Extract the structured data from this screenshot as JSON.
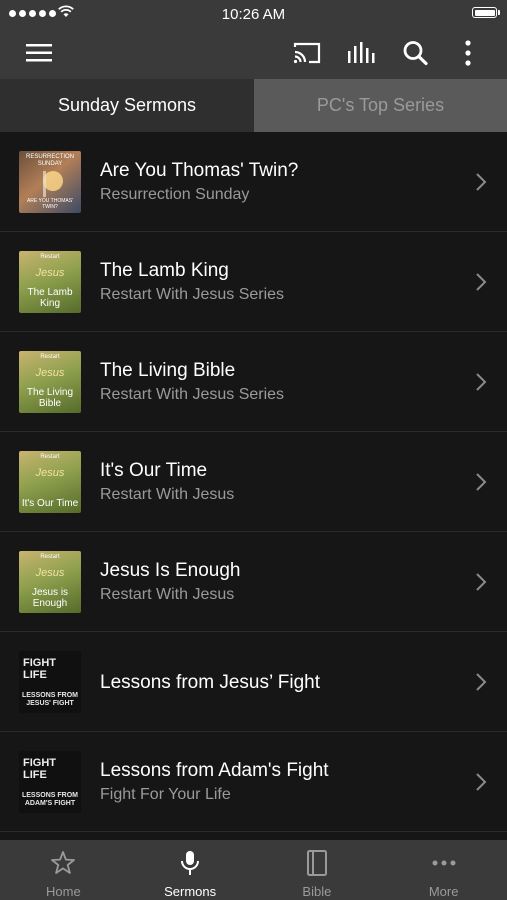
{
  "status_bar": {
    "time": "10:26 AM"
  },
  "tabs": [
    {
      "label": "Sunday Sermons",
      "selected": true
    },
    {
      "label": "PC's Top Series",
      "selected": false
    }
  ],
  "sermons": [
    {
      "title": "Are You Thomas' Twin?",
      "subtitle": "Resurrection Sunday",
      "thumb": {
        "top": "RESURRECTION SUNDAY",
        "caption": "ARE YOU THOMAS' TWIN?"
      }
    },
    {
      "title": "The Lamb King",
      "subtitle": "Restart With Jesus Series",
      "thumb": {
        "top": "Restart",
        "mid": "Jesus",
        "caption": "The Lamb King"
      }
    },
    {
      "title": "The Living Bible",
      "subtitle": "Restart With Jesus Series",
      "thumb": {
        "top": "Restart",
        "mid": "Jesus",
        "caption": "The Living Bible"
      }
    },
    {
      "title": "It's Our Time",
      "subtitle": "Restart With Jesus",
      "thumb": {
        "top": "Restart",
        "mid": "Jesus",
        "caption": "It's Our Time"
      }
    },
    {
      "title": "Jesus Is Enough",
      "subtitle": "Restart With Jesus",
      "thumb": {
        "top": "Restart",
        "mid": "Jesus",
        "caption": "Jesus is Enough"
      }
    },
    {
      "title": "Lessons from Jesus’ Fight",
      "subtitle": "",
      "thumb": {
        "top": "FIGHT LIFE",
        "caption": "LESSONS FROM JESUS' FIGHT"
      }
    },
    {
      "title": "Lessons from Adam's Fight",
      "subtitle": "Fight For Your Life",
      "thumb": {
        "top": "FIGHT LIFE",
        "caption": "LESSONS FROM ADAM'S FIGHT"
      }
    }
  ],
  "bottom_nav": [
    {
      "label": "Home",
      "icon": "star-icon",
      "active": false
    },
    {
      "label": "Sermons",
      "icon": "microphone-icon",
      "active": true
    },
    {
      "label": "Bible",
      "icon": "book-icon",
      "active": false
    },
    {
      "label": "More",
      "icon": "more-dots-icon",
      "active": false
    }
  ],
  "colors": {
    "background": "#161617",
    "bar": "#3a3a3a",
    "inactive_tab": "#5a5a5a",
    "secondary_text": "#9a9a9a"
  }
}
